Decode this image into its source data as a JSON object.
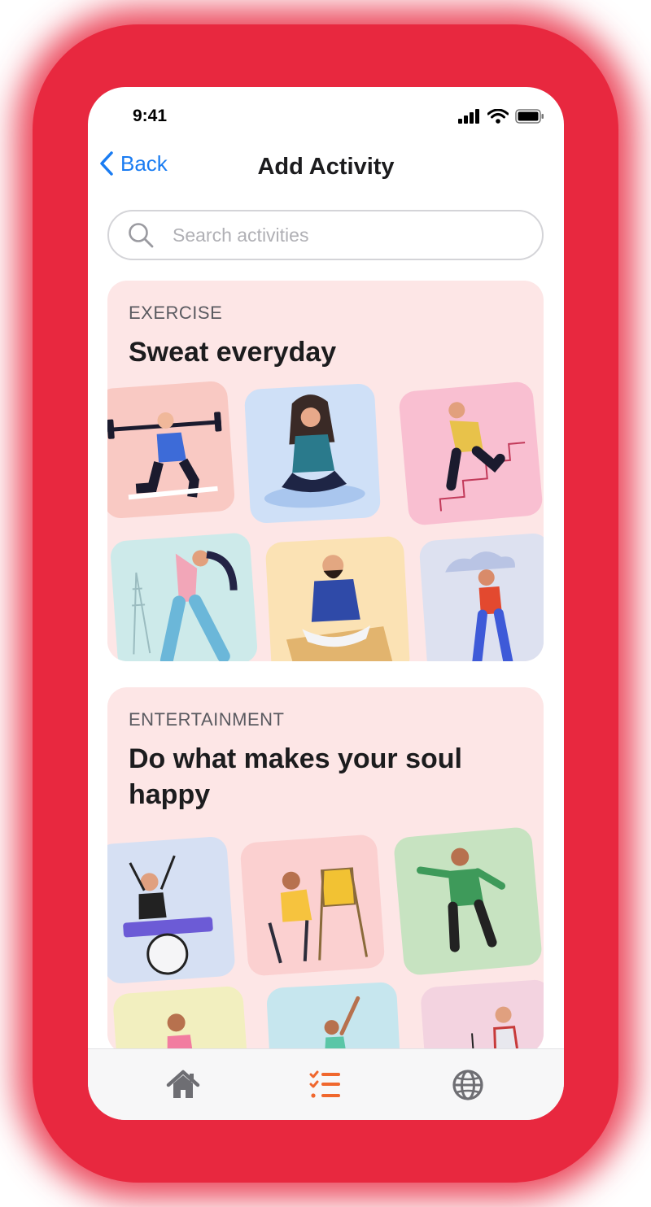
{
  "status_bar": {
    "time": "9:41"
  },
  "navbar": {
    "back_label": "Back",
    "title": "Add Activity"
  },
  "search": {
    "placeholder": "Search activities"
  },
  "categories": [
    {
      "eyebrow": "EXERCISE",
      "headline": "Sweat everyday",
      "activities": [
        "weightlifting",
        "yoga",
        "stair-climbing",
        "stretching",
        "meditation",
        "walking"
      ]
    },
    {
      "eyebrow": "ENTERTAINMENT",
      "headline": "Do what makes your soul happy",
      "activities": [
        "drumming",
        "painting",
        "dancing",
        "singing",
        "ballet",
        "performing"
      ]
    }
  ],
  "tab_bar": {
    "items": [
      {
        "icon": "home-icon",
        "active": false
      },
      {
        "icon": "checklist-icon",
        "active": true
      },
      {
        "icon": "globe-icon",
        "active": false
      }
    ]
  },
  "colors": {
    "accent_blue": "#1a7cf2",
    "active_tab": "#f0672d",
    "inactive_tab": "#6e6e73",
    "card_bg": "#fde6e6",
    "frame_red": "#e8283f"
  }
}
